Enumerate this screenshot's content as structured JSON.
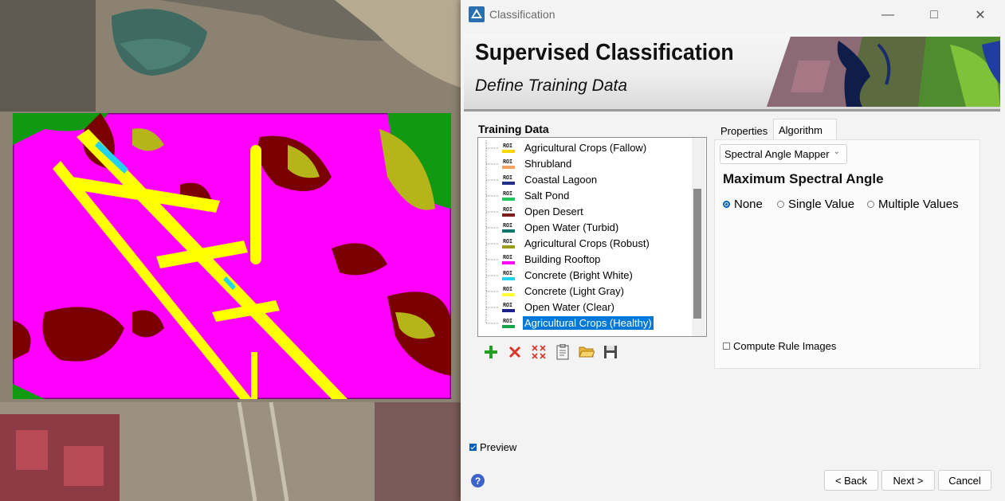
{
  "window": {
    "title": "Classification",
    "controls": [
      "minimize-icon",
      "maximize-icon",
      "close-icon"
    ]
  },
  "banner": {
    "title": "Supervised Classification",
    "subtitle": "Define Training Data"
  },
  "training_data": {
    "label": "Training Data",
    "items": [
      {
        "label": "Agricultural Crops (Fallow)",
        "color": "#ffd700",
        "selected": false
      },
      {
        "label": "Shrubland",
        "color": "#f4a261",
        "selected": false
      },
      {
        "label": "Coastal Lagoon",
        "color": "#1f2f8a",
        "selected": false
      },
      {
        "label": "Salt Pond",
        "color": "#22c55e",
        "selected": false
      },
      {
        "label": "Open Desert",
        "color": "#7f1d1d",
        "selected": false
      },
      {
        "label": "Open Water (Turbid)",
        "color": "#0f766e",
        "selected": false
      },
      {
        "label": "Agricultural Crops (Robust)",
        "color": "#9b9b1a",
        "selected": false
      },
      {
        "label": "Building Rooftop",
        "color": "#ff00ff",
        "selected": false
      },
      {
        "label": "Concrete (Bright White)",
        "color": "#22d3ee",
        "selected": false
      },
      {
        "label": "Concrete (Light Gray)",
        "color": "#ffff33",
        "selected": false
      },
      {
        "label": "Open Water (Clear)",
        "color": "#1e1e8f",
        "selected": false
      },
      {
        "label": "Agricultural Crops (Healthy)",
        "color": "#16a34a",
        "selected": true
      }
    ],
    "roi_tag": "ROI",
    "tools": [
      "add-icon",
      "delete-icon",
      "delete-all-icon",
      "clipboard-icon",
      "open-folder-icon",
      "save-icon"
    ]
  },
  "tabs": {
    "properties": "Properties",
    "algorithm": "Algorithm",
    "active": "algorithm"
  },
  "algorithm": {
    "method": "Spectral Angle Mapper",
    "heading": "Maximum Spectral Angle",
    "options": [
      "None",
      "Single Value",
      "Multiple Values"
    ],
    "selected_option": "None",
    "compute_rule_images_label": "Compute Rule Images",
    "compute_rule_images_checked": false
  },
  "footer": {
    "preview_label": "Preview",
    "preview_checked": true,
    "help": "?",
    "back": "< Back",
    "next": "Next >",
    "cancel": "Cancel"
  },
  "colors": {
    "selection": "#0078d7",
    "accent": "#005fb8",
    "class_magenta": "#ff00ff",
    "class_yellow": "#ffff00",
    "class_maroon": "#7a0000",
    "class_green": "#119a11",
    "class_olive": "#b5b51a",
    "class_cyan": "#22d3ee"
  }
}
